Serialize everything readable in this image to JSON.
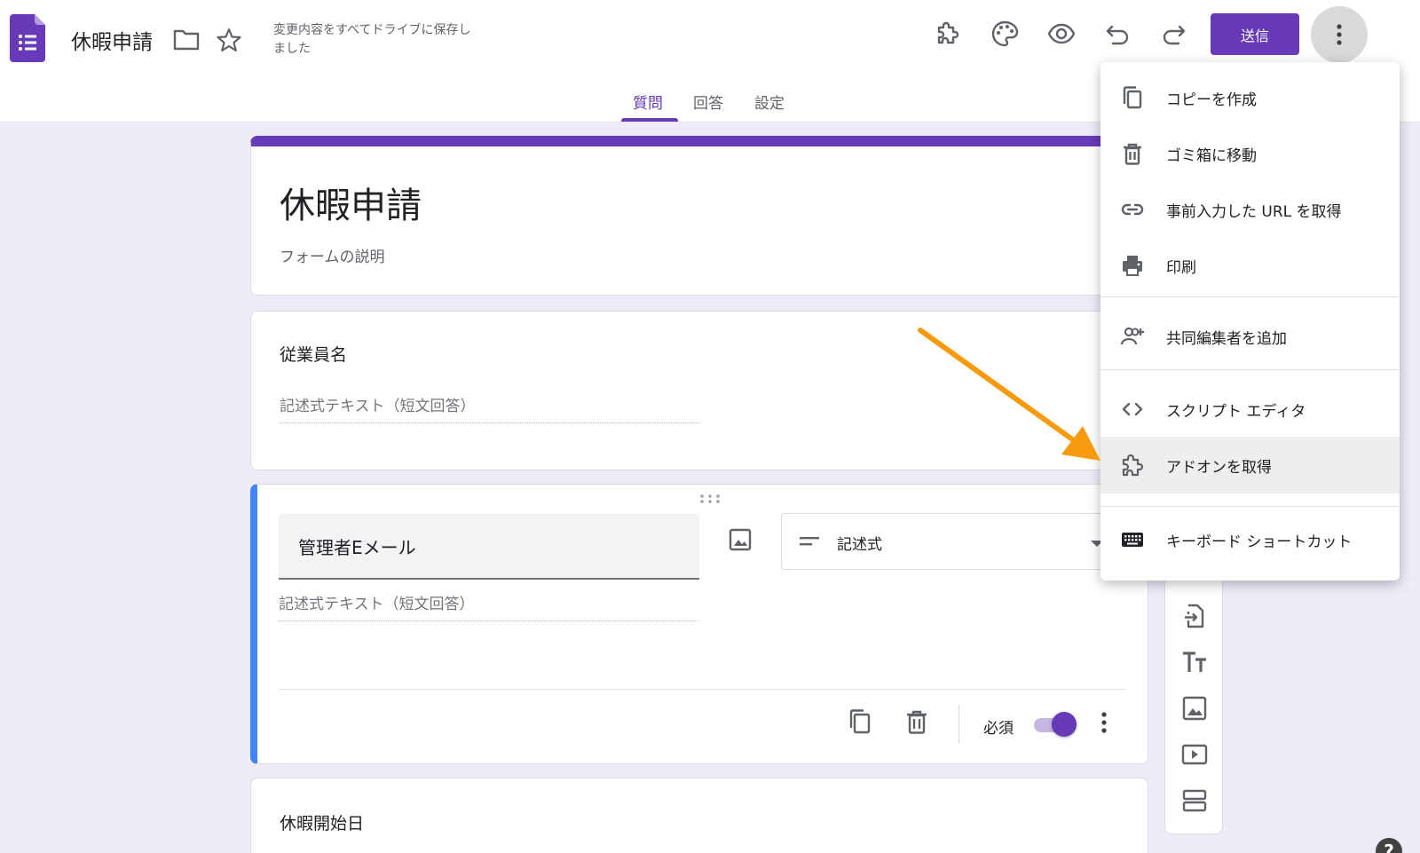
{
  "app": {
    "title": "休暇申請",
    "save_status": "変更内容をすべてドライブに保存しました"
  },
  "toolbar": {
    "send_label": "送信"
  },
  "tabs": [
    {
      "label": "質問",
      "active": true
    },
    {
      "label": "回答",
      "active": false
    },
    {
      "label": "設定",
      "active": false
    }
  ],
  "form": {
    "title": "休暇申請",
    "description_placeholder": "フォームの説明",
    "questions": [
      {
        "title": "従業員名",
        "answer_hint": "記述式テキスト（短文回答）"
      },
      {
        "title": "管理者Eメール",
        "answer_hint": "記述式テキスト（短文回答）",
        "type": "記述式",
        "required_label": "必須",
        "required": true
      },
      {
        "title": "休暇開始日"
      }
    ]
  },
  "menu": {
    "items": [
      {
        "label": "コピーを作成",
        "icon": "copy-icon"
      },
      {
        "label": "ゴミ箱に移動",
        "icon": "trash-icon"
      },
      {
        "label": "事前入力した URL を取得",
        "icon": "link-icon"
      },
      {
        "label": "印刷",
        "icon": "print-icon"
      },
      {
        "label": "共同編集者を追加",
        "icon": "add-people-icon"
      },
      {
        "label": "スクリプト エディタ",
        "icon": "code-icon"
      },
      {
        "label": "アドオンを取得",
        "icon": "puzzle-icon",
        "highlighted": true
      },
      {
        "label": "キーボード ショートカット",
        "icon": "keyboard-icon"
      }
    ]
  },
  "colors": {
    "accent": "#673ab7",
    "page_bg": "#efebf8",
    "annotation_arrow": "#f79a0e",
    "question_focus": "#4285f4"
  },
  "help": {
    "label": "?"
  }
}
